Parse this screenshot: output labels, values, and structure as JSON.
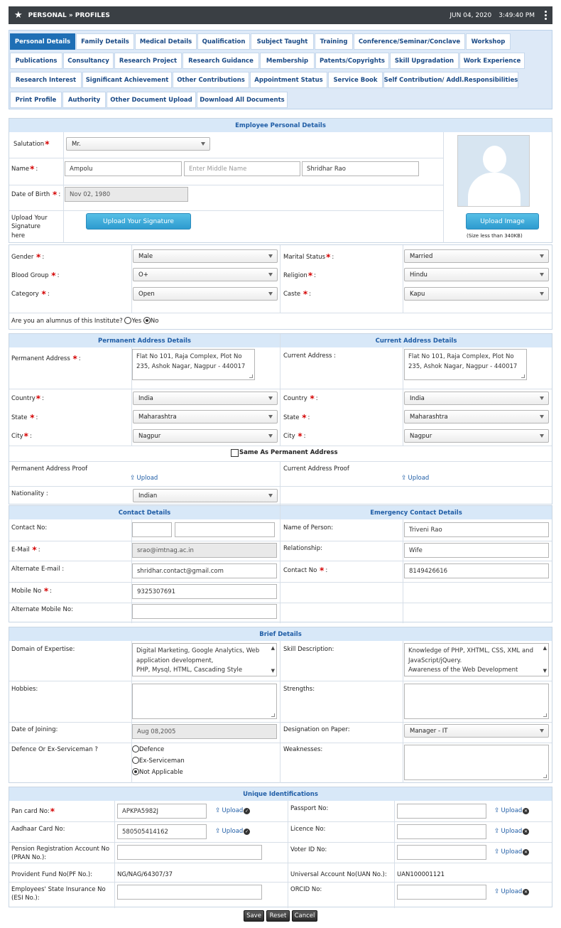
{
  "topbar": {
    "title": "PERSONAL » PROFILES",
    "date": "JUN 04, 2020",
    "time": "3:49:40 PM"
  },
  "tabs": [
    "Personal Details",
    "Family Details",
    "Medical Details",
    "Qualification",
    "Subject Taught",
    "Training",
    "Conference/Seminar/Conclave",
    "Workshop",
    "Publications",
    "Consultancy",
    "Research Project",
    "Research Guidance",
    "Membership",
    "Patents/Copyrights",
    "Skill Upgradation",
    "Work Experience",
    "Research Interest",
    "Significant Achievement",
    "Other Contributions",
    "Appointment Status",
    "Service Book",
    "Self Contribution/ Addl.Responsibilities",
    "Print Profile",
    "Authority",
    "Other Document Upload",
    "Download All Documents"
  ],
  "personal": {
    "header": "Employee Personal Details",
    "salutation_label": "Salutation",
    "salutation": "Mr.",
    "name_label": "Name",
    "first_name": "Ampolu",
    "middle_placeholder": "Enter Middle Name",
    "last_name": "Shridhar Rao",
    "dob_label": "Date of Birth",
    "dob": "Nov 02, 1980",
    "signature_label": "Upload Your Signature here",
    "signature_button": "Upload Your Signature",
    "image_button": "Upload Image",
    "image_hint": "(Size less than 340KB)"
  },
  "demo": {
    "gender_label": "Gender",
    "gender": "Male",
    "marital_label": "Marital Status",
    "marital": "Married",
    "blood_label": "Blood Group",
    "blood": "O+",
    "religion_label": "Religion",
    "religion": "Hindu",
    "category_label": "Category",
    "category": "Open",
    "caste_label": "Caste",
    "caste": "Kapu",
    "alumnus_question": "Are you an alumnus of this Institute?",
    "yes": "Yes",
    "no": "No"
  },
  "address": {
    "perm_header": "Permanent Address Details",
    "curr_header": "Current Address Details",
    "perm_label": "Permanent Address",
    "perm_line1": "Flat No 101, Raja Complex, Plot No",
    "perm_line2": "235, Ashok Nagar, Nagpur - 440017",
    "curr_label": "Current Address :",
    "curr_line1": "Flat No 101, Raja Complex, Plot No",
    "curr_line2": "235, Ashok Nagar, Nagpur - 440017",
    "country_label": "Country",
    "state_label": "State",
    "city_label": "City",
    "perm_country": "India",
    "perm_state": "Maharashtra",
    "perm_city": "Nagpur",
    "curr_country": "India",
    "curr_state": "Maharashtra",
    "curr_city": "Nagpur",
    "same_label": "Same As Permanent Address",
    "perm_proof_label": "Permanent Address Proof",
    "curr_proof_label": "Current Address Proof",
    "upload": "Upload",
    "nationality_label": "Nationality :",
    "nationality": "Indian"
  },
  "contact": {
    "header": "Contact Details",
    "emer_header": "Emergency Contact Details",
    "contact_label": "Contact No:",
    "email_label": "E-Mail",
    "email": "srao@imtnag.ac.in",
    "alt_email_label": "Alternate E-mail :",
    "alt_email": "shridhar.contact@gmail.com",
    "mobile_label": "Mobile No",
    "mobile": "9325307691",
    "alt_mobile_label": "Alternate Mobile No:",
    "person_label": "Name of Person:",
    "person": "Triveni Rao",
    "relation_label": "Relationship:",
    "relation": "Wife",
    "emer_contact_label": "Contact No",
    "emer_contact": "8149426616"
  },
  "brief": {
    "header": "Brief Details",
    "domain_label": "Domain of Expertise:",
    "domain_lines": [
      "Digital Marketing, Google Analytics, Web",
      "application development,",
      "PHP, Mysql, HTML, Cascading Style"
    ],
    "skill_label": "Skill Description:",
    "skill_lines": [
      "Knowledge of PHP, XHTML, CSS, XML and",
      "JavaScript/jQuery.",
      "Awareness of the Web Development"
    ],
    "hobbies_label": "Hobbies:",
    "strengths_label": "Strengths:",
    "doj_label": "Date of Joining:",
    "doj": "Aug 08,2005",
    "designation_label": "Designation on Paper:",
    "designation": "Manager - IT",
    "defence_label": "Defence Or Ex-Serviceman ?",
    "opt_defence": "Defence",
    "opt_ex": "Ex-Serviceman",
    "opt_na": "Not Applicable",
    "weak_label": "Weaknesses:"
  },
  "ids": {
    "header": "Unique Identifications",
    "pan_label": "Pan card No:",
    "pan": "APKPA5982J",
    "aadhaar_label": "Aadhaar Card No:",
    "aadhaar": "580505414162",
    "pran_label": "Pension Registration Account No (PRAN No.):",
    "pf_label": "Provident Fund No(PF No.):",
    "pf": "NG/NAG/64307/37",
    "esi_label": "Employees' State Insurance No (ESI No.):",
    "passport_label": "Passport No:",
    "licence_label": "Licence No:",
    "voter_label": "Voter ID No:",
    "uan_label": "Universal Account No(UAN No.):",
    "uan": "UAN100001121",
    "orcid_label": "ORCID No:",
    "upload": "Upload"
  },
  "buttons": {
    "save": "Save",
    "reset": "Reset",
    "cancel": "Cancel"
  }
}
